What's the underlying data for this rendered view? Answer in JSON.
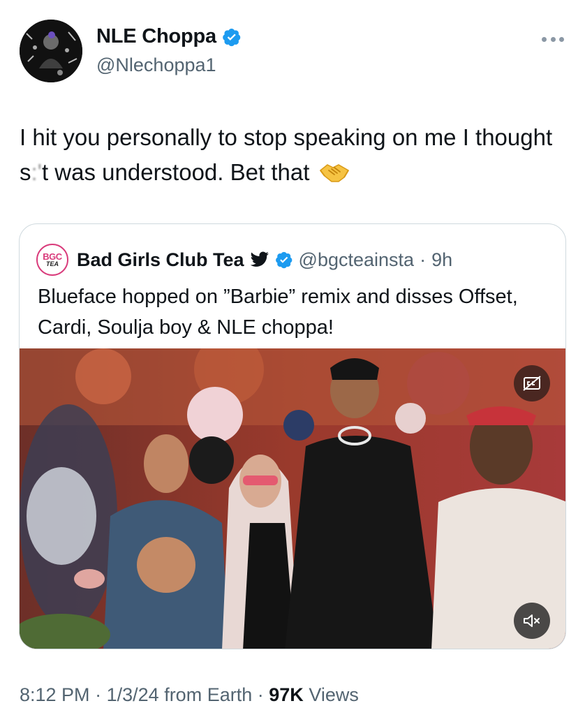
{
  "author": {
    "display_name": "NLE Choppa",
    "handle": "@Nlechoppa1",
    "verified": true
  },
  "tweet": {
    "text_before": "I hit you personally to stop speaking on me I thought s",
    "text_censored": ":'",
    "text_after": "t was understood. Bet that",
    "emoji": "handshake-emoji"
  },
  "quote": {
    "avatar_text_top": "BGC",
    "avatar_text_bottom": "TEA",
    "display_name": "Bad Girls Club Tea",
    "handle": "@bgcteainsta",
    "separator": "·",
    "time": "9h",
    "text": "Blueface hopped on ”Barbie” remix and disses Offset, Cardi, Soulja boy & NLE choppa!",
    "media": {
      "icons": [
        "closed-captions-icon",
        "mute-icon"
      ]
    }
  },
  "footer": {
    "time": "8:12 PM",
    "date": "1/3/24",
    "source": "from Earth",
    "views_count": "97K",
    "views_label": "Views",
    "sep": "·"
  },
  "colors": {
    "verified_blue": "#1d9bf0",
    "secondary_text": "#536471",
    "border": "#cfd9de"
  }
}
